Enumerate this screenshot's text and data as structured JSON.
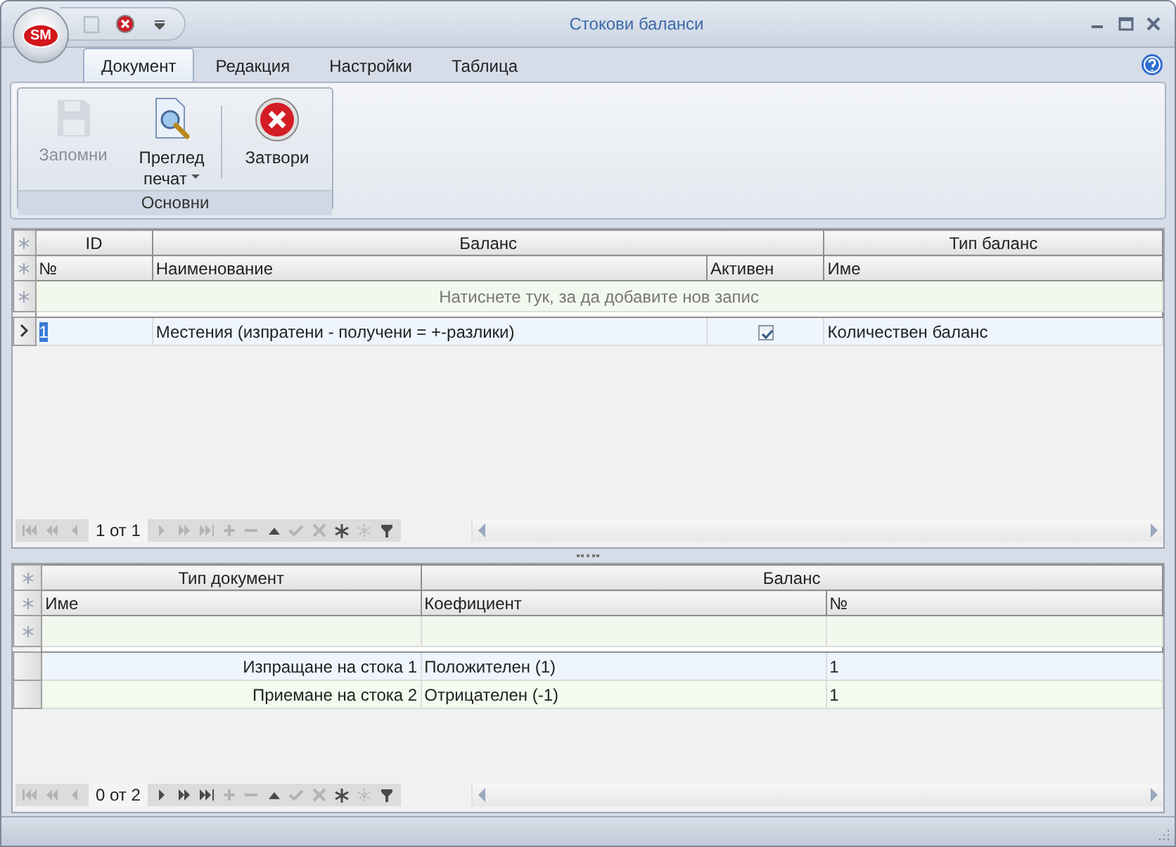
{
  "window": {
    "title": "Стокови баланси"
  },
  "app_button": {
    "label": "SM"
  },
  "quick_access": [
    {
      "kind": "save",
      "disabled": true
    },
    {
      "kind": "close",
      "disabled": false
    }
  ],
  "ribbon": {
    "tabs": [
      {
        "label": "Документ",
        "selected": true
      },
      {
        "label": "Редакция",
        "selected": false
      },
      {
        "label": "Настройки",
        "selected": false
      },
      {
        "label": "Таблица",
        "selected": false
      }
    ],
    "groups": [
      {
        "label": "Основни",
        "buttons": [
          {
            "kind": "save",
            "label": "Запомни",
            "disabled": true,
            "has_menu": false
          },
          {
            "kind": "preview",
            "label": "Преглед печат",
            "disabled": false,
            "has_menu": true
          },
          {
            "kind": "close",
            "label": "Затвори",
            "disabled": false,
            "has_menu": false
          }
        ]
      }
    ]
  },
  "grids": [
    {
      "bands": [
        {
          "label": "ID",
          "columns": [
            {
              "label": "№",
              "kind": "text"
            }
          ]
        },
        {
          "label": "Баланс",
          "columns": [
            {
              "label": "Наименование",
              "kind": "text"
            },
            {
              "label": "Активен",
              "kind": "check"
            }
          ]
        },
        {
          "label": "Тип баланс",
          "columns": [
            {
              "label": "Име",
              "kind": "text"
            }
          ]
        }
      ],
      "new_row_hint": "Натиснете тук, за да добавите нов запис",
      "rows": [
        {
          "selected": true,
          "cells": [
            {
              "text": "1",
              "highlighted": true
            },
            {
              "text": "Местения (изпратени - получени = +-разлики)",
              "highlighted": false
            },
            {
              "checked": true
            },
            {
              "text": "Количествен баланс",
              "highlighted": false
            }
          ]
        }
      ],
      "navigator": {
        "position": "1 от 1",
        "buttons": [
          {
            "kind": "first",
            "disabled": true
          },
          {
            "kind": "prev_page",
            "disabled": true
          },
          {
            "kind": "prev",
            "disabled": true
          },
          {
            "kind": "next",
            "disabled": true
          },
          {
            "kind": "next_page",
            "disabled": true
          },
          {
            "kind": "last",
            "disabled": true
          },
          {
            "kind": "append",
            "disabled": true
          },
          {
            "kind": "remove",
            "disabled": true
          },
          {
            "kind": "up",
            "disabled": false
          },
          {
            "kind": "apply",
            "disabled": true
          },
          {
            "kind": "cancel",
            "disabled": true
          },
          {
            "kind": "star",
            "disabled": false
          },
          {
            "kind": "star_outline",
            "disabled": true
          },
          {
            "kind": "filter",
            "disabled": false
          }
        ]
      }
    },
    {
      "bands": [
        {
          "label": "Тип документ",
          "columns": [
            {
              "label": "Име",
              "kind": "lookup"
            }
          ]
        },
        {
          "label": "Баланс",
          "columns": [
            {
              "label": "Коефициент",
              "kind": "text"
            },
            {
              "label": "№",
              "kind": "text"
            }
          ]
        }
      ],
      "rows": [
        {
          "selected": false,
          "cells": [
            {
              "text": "Изпращане на стока 1",
              "highlighted": false
            },
            {
              "text": "Положителен (1)",
              "highlighted": false
            },
            {
              "text": "1",
              "highlighted": false
            }
          ]
        },
        {
          "selected": false,
          "cells": [
            {
              "text": "Приемане на стока 2",
              "highlighted": false
            },
            {
              "text": "Отрицателен (-1)",
              "highlighted": false
            },
            {
              "text": "1",
              "highlighted": false
            }
          ]
        }
      ],
      "navigator": {
        "position": "0 от 2",
        "buttons": [
          {
            "kind": "first",
            "disabled": true
          },
          {
            "kind": "prev_page",
            "disabled": true
          },
          {
            "kind": "prev",
            "disabled": true
          },
          {
            "kind": "next",
            "disabled": false
          },
          {
            "kind": "next_page",
            "disabled": false
          },
          {
            "kind": "last",
            "disabled": false
          },
          {
            "kind": "append",
            "disabled": true
          },
          {
            "kind": "remove",
            "disabled": true
          },
          {
            "kind": "up",
            "disabled": false
          },
          {
            "kind": "apply",
            "disabled": true
          },
          {
            "kind": "cancel",
            "disabled": true
          },
          {
            "kind": "star",
            "disabled": false
          },
          {
            "kind": "star_outline",
            "disabled": true
          },
          {
            "kind": "filter",
            "disabled": false
          }
        ]
      }
    }
  ]
}
